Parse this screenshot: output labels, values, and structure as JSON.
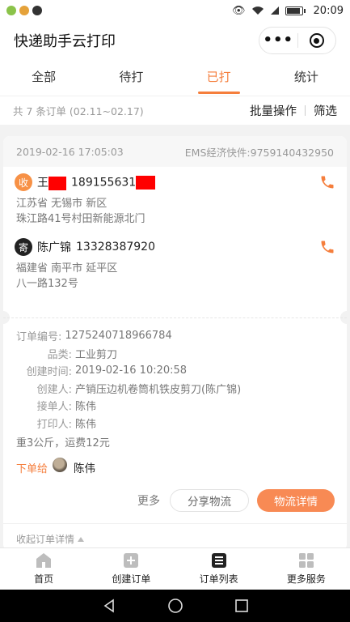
{
  "status_bar": {
    "time": "20:09"
  },
  "header": {
    "title": "快递助手云打印"
  },
  "tabs": [
    {
      "label": "全部",
      "active": false
    },
    {
      "label": "待打",
      "active": false
    },
    {
      "label": "已打",
      "active": true
    },
    {
      "label": "统计",
      "active": false
    }
  ],
  "filter": {
    "summary": "共 7 条订单 (02.11~02.17)",
    "batch_label": "批量操作",
    "filter_label": "筛选"
  },
  "order": {
    "printed_time": "2019-02-16 17:05:03",
    "carrier_waybill": "EMS经济快件:9759140432950",
    "receiver": {
      "badge": "收",
      "name": "王",
      "phone": "189155631",
      "address_line1": "江苏省 无锡市 新区",
      "address_line2": "珠江路41号村田新能源北门"
    },
    "sender": {
      "badge": "寄",
      "name": "陈广锦",
      "phone": "13328387920",
      "address_line1": "福建省 南平市 延平区",
      "address_line2": "八一路132号"
    },
    "details": [
      {
        "label": "订单编号:",
        "value": "1275240718966784"
      },
      {
        "label": "品类:",
        "value": "工业剪刀"
      },
      {
        "label": "创建时间:",
        "value": "2019-02-16 10:20:58"
      },
      {
        "label": "创建人:",
        "value": "产销压边机卷筒机铁皮剪刀(陈广锦)"
      },
      {
        "label": "接单人:",
        "value": "陈伟"
      },
      {
        "label": "打印人:",
        "value": "陈伟"
      }
    ],
    "weight_fee": "重3公斤，运费12元",
    "assign_label": "下单给",
    "assign_name": "陈伟",
    "more_label": "更多",
    "share_label": "分享物流",
    "logistics_label": "物流详情",
    "collapse_label": "收起订单详情"
  },
  "bottom_nav": [
    {
      "label": "首页",
      "icon": "home-icon"
    },
    {
      "label": "创建订单",
      "icon": "plus-square-icon"
    },
    {
      "label": "订单列表",
      "icon": "list-icon"
    },
    {
      "label": "更多服务",
      "icon": "grid-icon"
    }
  ],
  "colors": {
    "accent": "#f57e3c",
    "button": "#f88a54",
    "redaction": "#ff0000"
  }
}
